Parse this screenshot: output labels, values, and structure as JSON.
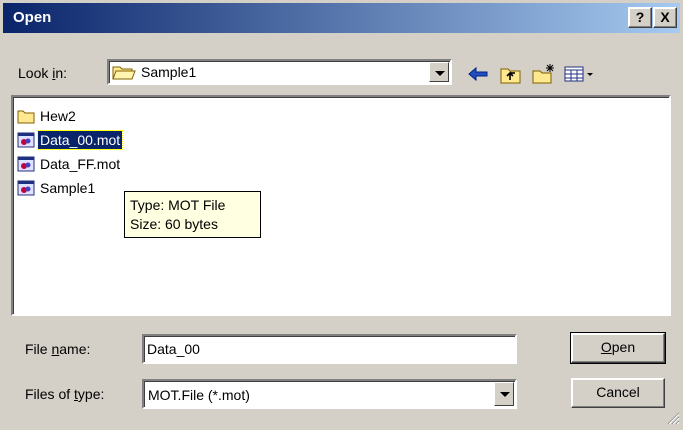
{
  "window": {
    "title": "Open",
    "help_label": "?",
    "close_label": "X"
  },
  "lookin": {
    "label_pre": "Look ",
    "label_u": "i",
    "label_post": "n:",
    "value": "Sample1"
  },
  "toolbar": {
    "icons": [
      "back-icon",
      "up-folder-icon",
      "new-folder-icon",
      "view-menu-icon"
    ]
  },
  "files": [
    {
      "name": "Hew2",
      "type": "folder",
      "selected": false
    },
    {
      "name": "Data_00.mot",
      "type": "file",
      "selected": true
    },
    {
      "name": "Data_FF.mot",
      "type": "file",
      "selected": false
    },
    {
      "name": "Sample1",
      "type": "file",
      "selected": false
    }
  ],
  "tooltip": {
    "type_line": "Type: MOT File",
    "size_line": "Size: 60 bytes"
  },
  "filename": {
    "label_pre": "File ",
    "label_u": "n",
    "label_post": "ame:",
    "value": "Data_00"
  },
  "filetype": {
    "label_pre": "Files of ",
    "label_u": "t",
    "label_post": "ype:",
    "value": "MOT.File (*.mot)"
  },
  "buttons": {
    "open_u": "O",
    "open_rest": "pen",
    "cancel": "Cancel"
  },
  "colors": {
    "title_start": "#0a246a",
    "title_end": "#a6caf0",
    "face": "#d4d0c8",
    "selection": "#0a246a",
    "tooltip_bg": "#ffffe1"
  }
}
